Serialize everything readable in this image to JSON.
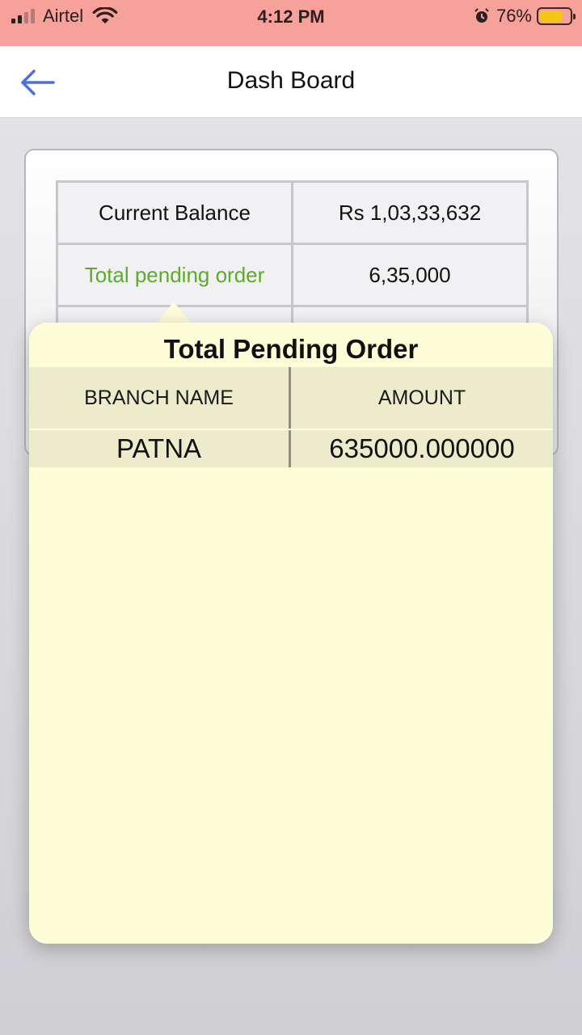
{
  "status_bar": {
    "carrier": "Airtel",
    "time": "4:12 PM",
    "battery_percent": "76%",
    "battery_level": 0.76,
    "icons": [
      "signal-icon",
      "wifi-icon",
      "alarm-icon",
      "battery-icon"
    ]
  },
  "nav": {
    "title": "Dash Board",
    "back_icon": "back-arrow-icon",
    "accent_color": "#4a6fe0"
  },
  "dashboard": {
    "rows": [
      {
        "label": "Current Balance",
        "value": "Rs 1,03,33,632"
      },
      {
        "label": "Total pending order",
        "value": "6,35,000",
        "label_color": "#5daa2c"
      }
    ]
  },
  "popover": {
    "title": "Total Pending Order",
    "columns": [
      "BRANCH NAME",
      "AMOUNT"
    ],
    "rows": [
      {
        "branch": "PATNA",
        "amount": "635000.000000"
      }
    ],
    "background_color": "#fdfdd8"
  }
}
